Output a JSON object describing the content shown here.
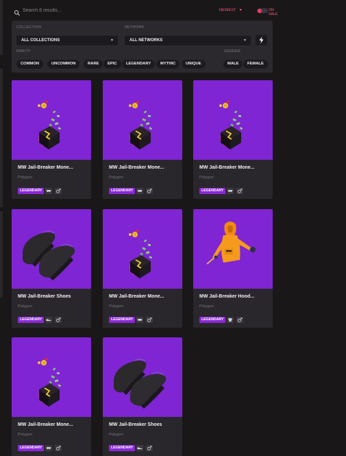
{
  "search": {
    "placeholder": "Search 8 results..."
  },
  "sort": {
    "label": "NEWEST"
  },
  "on_sale": {
    "label": "ON SALE",
    "enabled": true
  },
  "filters": {
    "collection_label": "COLLECTION",
    "collection_value": "ALL COLLECTIONS",
    "network_label": "NETWORK",
    "network_value": "ALL NETWORKS",
    "rarity_label": "RARITY",
    "rarities": [
      "COMMON",
      "UNCOMMON",
      "RARE",
      "EPIC",
      "LEGENDARY",
      "MYTHIC",
      "UNIQUE"
    ],
    "gender_label": "GENDER",
    "genders": [
      "MALE",
      "FEMALE"
    ]
  },
  "colors": {
    "accent": "#ff3a64",
    "card_image_bg": "#7f25d3",
    "legendary": "#8a28d6"
  },
  "items": [
    {
      "title": "MW Jail-Breaker Mone...",
      "network": "Polygon",
      "rarity": "LEGENDARY",
      "category_icon": "mask-icon",
      "gender_icon": "male-icon",
      "art": "money-box"
    },
    {
      "title": "MW Jail-Breaker Mone...",
      "network": "Polygon",
      "rarity": "LEGENDARY",
      "category_icon": "mask-icon",
      "gender_icon": "male-icon",
      "art": "money-box"
    },
    {
      "title": "MW Jail-Breaker Mone...",
      "network": "Polygon",
      "rarity": "LEGENDARY",
      "category_icon": "mask-icon",
      "gender_icon": "male-icon",
      "art": "money-box"
    },
    {
      "title": "MW Jail-Breaker Shoes",
      "network": "Polygon",
      "rarity": "LEGENDARY",
      "category_icon": "shoe-icon",
      "gender_icon": "male-icon",
      "art": "shoes"
    },
    {
      "title": "MW Jail-Breaker Mone...",
      "network": "Polygon",
      "rarity": "LEGENDARY",
      "category_icon": "mask-icon",
      "gender_icon": "male-icon",
      "art": "money-box"
    },
    {
      "title": "MW Jail-Breaker Hood...",
      "network": "Polygon",
      "rarity": "LEGENDARY",
      "category_icon": "shirt-icon",
      "gender_icon": "male-icon",
      "art": "hoodie"
    },
    {
      "title": "MW Jail-Breaker Mone...",
      "network": "Polygon",
      "rarity": "LEGENDARY",
      "category_icon": "mask-icon",
      "gender_icon": "male-icon",
      "art": "money-box"
    },
    {
      "title": "MW Jail-Breaker Shoes",
      "network": "Polygon",
      "rarity": "LEGENDARY",
      "category_icon": "shoe-icon",
      "gender_icon": "male-icon",
      "art": "shoes"
    }
  ]
}
